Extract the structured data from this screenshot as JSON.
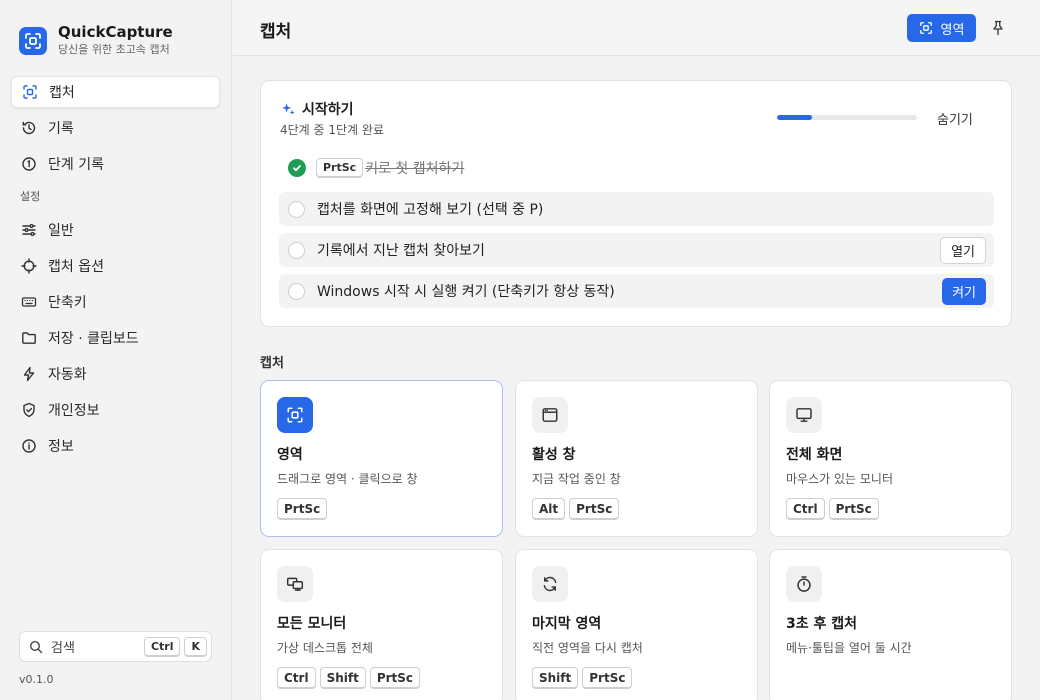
{
  "brand": {
    "name": "QuickCapture",
    "tagline": "당신을 위한 초고속 캡처"
  },
  "sidebar": {
    "items": [
      {
        "label": "캡처",
        "icon": "capture-icon"
      },
      {
        "label": "기록",
        "icon": "history-icon"
      },
      {
        "label": "단계 기록",
        "icon": "step-record-icon"
      }
    ],
    "settings_label": "설정",
    "settings_items": [
      {
        "label": "일반",
        "icon": "sliders-icon"
      },
      {
        "label": "캡처 옵션",
        "icon": "crosshair-icon"
      },
      {
        "label": "단축키",
        "icon": "keyboard-icon"
      },
      {
        "label": "저장 · 클립보드",
        "icon": "folder-icon"
      },
      {
        "label": "자동화",
        "icon": "bolt-icon"
      },
      {
        "label": "개인정보",
        "icon": "shield-icon"
      },
      {
        "label": "정보",
        "icon": "info-icon"
      }
    ],
    "search": {
      "label": "검색",
      "keys": [
        "Ctrl",
        "K"
      ]
    },
    "version": "v0.1.0"
  },
  "header": {
    "title": "캡처",
    "region_button": "영역"
  },
  "getting_started": {
    "title": "시작하기",
    "subtitle": "4단계 중 1단계 완료",
    "progress": 0.25,
    "hide_label": "숨기기",
    "steps": [
      {
        "key": "PrtSc",
        "label": "키로 첫 캡처하기",
        "done": true
      },
      {
        "label": "캡처를 화면에 고정해 보기 (선택 중 P)",
        "done": false
      },
      {
        "label": "기록에서 지난 캡처 찾아보기",
        "done": false,
        "action": "열기"
      },
      {
        "label": "Windows 시작 시 실행 켜기 (단축키가 항상 동작)",
        "done": false,
        "action": "켜기"
      }
    ]
  },
  "capture_section": {
    "label": "캡처",
    "modes": [
      {
        "title": "영역",
        "desc": "드래그로 영역 · 클릭으로 창",
        "keys": [
          "PrtSc"
        ],
        "icon": "region-icon"
      },
      {
        "title": "활성 창",
        "desc": "지금 작업 중인 창",
        "keys": [
          "Alt",
          "PrtSc"
        ],
        "icon": "window-icon"
      },
      {
        "title": "전체 화면",
        "desc": "마우스가 있는 모니터",
        "keys": [
          "Ctrl",
          "PrtSc"
        ],
        "icon": "monitor-icon"
      },
      {
        "title": "모든 모니터",
        "desc": "가상 데스크톱 전체",
        "keys": [
          "Ctrl",
          "Shift",
          "PrtSc"
        ],
        "icon": "multi-monitor-icon"
      },
      {
        "title": "마지막 영역",
        "desc": "직전 영역을 다시 캡처",
        "keys": [
          "Shift",
          "PrtSc"
        ],
        "icon": "refresh-icon"
      },
      {
        "title": "3초 후 캡처",
        "desc": "메뉴·툴팁을 열어 둘 시간",
        "keys": [],
        "icon": "timer-icon"
      }
    ]
  },
  "colors": {
    "accent": "#2668e8",
    "success": "#1f9d55"
  }
}
